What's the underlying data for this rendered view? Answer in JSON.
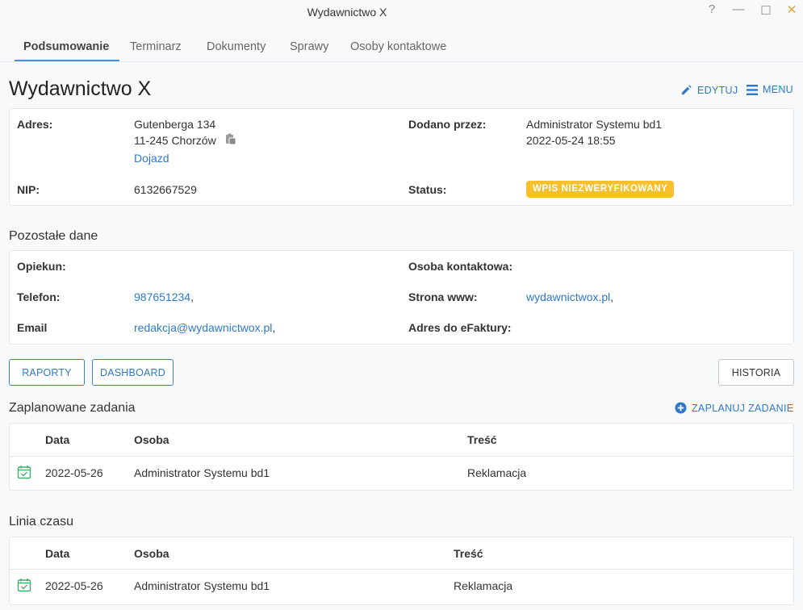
{
  "window": {
    "title": "Wydawnictwo X",
    "help_glyph": "?",
    "minimize_glyph": "—",
    "maximize_glyph": "☐",
    "close_glyph": "✕"
  },
  "tabs": [
    {
      "label": "Podsumowanie",
      "active": true
    },
    {
      "label": "Terminarz"
    },
    {
      "label": "Dokumenty"
    },
    {
      "label": "Sprawy"
    },
    {
      "label": "Osoby kontaktowe"
    }
  ],
  "page": {
    "title": "Wydawnictwo X",
    "edit_label": "EDYTUJ",
    "menu_label": "MENU"
  },
  "summary": {
    "address_label": "Adres:",
    "address_line1": "Gutenberga 134",
    "address_line2": "11-245 Chorzów",
    "directions_link": "Dojazd",
    "added_by_label": "Dodano przez:",
    "added_by_value": "Administrator Systemu bd1",
    "added_date": "2022-05-24 18:55",
    "nip_label": "NIP:",
    "nip_value": "6132667529",
    "status_label": "Status:",
    "status_value": "WPIS NIEZWERYFIKOWANY"
  },
  "other": {
    "title": "Pozostałe dane",
    "guardian_label": "Opiekun:",
    "contact_label": "Osoba kontaktowa:",
    "phone_label": "Telefon:",
    "phone_value": "987651234",
    "website_label": "Strona www:",
    "website_value": "wydawnictwox.pl",
    "email_label": "Email",
    "email_value": "redakcja@wydawnictwox.pl",
    "efaktura_label": "Adres do eFaktury:",
    "separator": ","
  },
  "buttons": {
    "reports": "RAPORTY",
    "dashboard": "DASHBOARD",
    "history": "HISTORIA"
  },
  "planned": {
    "title": "Zaplanowane zadania",
    "add_label": "ZAPLANUJ ZADANIE",
    "columns": [
      "Data",
      "Osoba",
      "Treść"
    ],
    "rows": [
      {
        "date": "2022-05-26",
        "person": "Administrator Systemu bd1",
        "content": "Reklamacja"
      }
    ]
  },
  "timeline": {
    "title": "Linia czasu",
    "columns": [
      "Data",
      "Osoba",
      "Treść"
    ],
    "rows": [
      {
        "date": "2022-05-26",
        "person": "Administrator Systemu bd1",
        "content": "Reklamacja"
      }
    ]
  },
  "colors": {
    "accent": "#2f79c7",
    "badge": "#f5c02b",
    "calendar_icon": "#3fae6b"
  }
}
